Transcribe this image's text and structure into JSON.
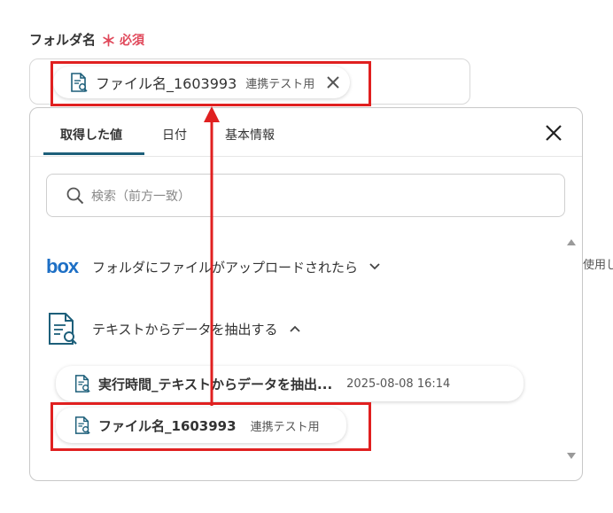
{
  "field": {
    "label": "フォルダ名",
    "required_star": "＊",
    "required_text": "必須",
    "selected_chip": {
      "name": "ファイル名_1603993",
      "sub": "連携テスト用"
    }
  },
  "tabs": [
    {
      "label": "取得した値"
    },
    {
      "label": "日付"
    },
    {
      "label": "基本情報"
    }
  ],
  "search": {
    "placeholder": "検索（前方一致）"
  },
  "sections": [
    {
      "logo": "box",
      "title": "フォルダにファイルがアップロードされたら"
    },
    {
      "title": "テキストからデータを抽出する"
    }
  ],
  "items": [
    {
      "name": "実行時間_テキストからデータを抽出...",
      "value": "2025-08-08 16:14"
    },
    {
      "name": "ファイル名_1603993",
      "value": "連携テスト用"
    }
  ],
  "side_text": "使用し",
  "colors": {
    "accent": "#1d5f7a",
    "required": "#e0485a",
    "highlight": "#e02020",
    "box_brand": "#1d6fc5"
  }
}
